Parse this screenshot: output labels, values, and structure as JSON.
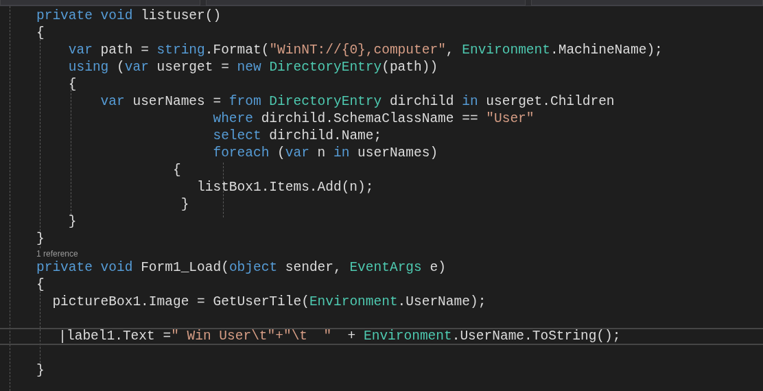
{
  "lines": [
    {
      "current": false,
      "tokens": [
        {
          "kind": "keyword",
          "text": "private"
        },
        {
          "kind": "keyword",
          "text": " void"
        },
        {
          "kind": "plain",
          "text": " listuser()"
        }
      ]
    },
    {
      "current": false,
      "tokens": [
        {
          "kind": "plain",
          "text": "{"
        }
      ]
    },
    {
      "current": false,
      "tokens": [
        {
          "kind": "keyword",
          "text": "    var"
        },
        {
          "kind": "plain",
          "text": " path = "
        },
        {
          "kind": "keyword",
          "text": "string"
        },
        {
          "kind": "plain",
          "text": ".Format("
        },
        {
          "kind": "string",
          "text": "\"WinNT://{0},computer\""
        },
        {
          "kind": "plain",
          "text": ", "
        },
        {
          "kind": "type",
          "text": "Environment"
        },
        {
          "kind": "plain",
          "text": ".MachineName);"
        }
      ]
    },
    {
      "current": false,
      "tokens": [
        {
          "kind": "keyword",
          "text": "    using"
        },
        {
          "kind": "plain",
          "text": " ("
        },
        {
          "kind": "keyword",
          "text": "var"
        },
        {
          "kind": "plain",
          "text": " userget = "
        },
        {
          "kind": "keyword",
          "text": "new"
        },
        {
          "kind": "type",
          "text": " DirectoryEntry"
        },
        {
          "kind": "plain",
          "text": "(path))"
        }
      ]
    },
    {
      "current": false,
      "tokens": [
        {
          "kind": "plain",
          "text": "    {"
        }
      ]
    },
    {
      "current": false,
      "tokens": [
        {
          "kind": "keyword",
          "text": "        var"
        },
        {
          "kind": "plain",
          "text": " userNames = "
        },
        {
          "kind": "keyword",
          "text": "from"
        },
        {
          "kind": "type",
          "text": " DirectoryEntry"
        },
        {
          "kind": "plain",
          "text": " dirchild "
        },
        {
          "kind": "keyword",
          "text": "in"
        },
        {
          "kind": "plain",
          "text": " userget.Children"
        }
      ]
    },
    {
      "current": false,
      "tokens": [
        {
          "kind": "keyword",
          "text": "                      where"
        },
        {
          "kind": "plain",
          "text": " dirchild.SchemaClassName == "
        },
        {
          "kind": "string",
          "text": "\"User\""
        }
      ]
    },
    {
      "current": false,
      "tokens": [
        {
          "kind": "keyword",
          "text": "                      select"
        },
        {
          "kind": "plain",
          "text": " dirchild.Name;"
        }
      ]
    },
    {
      "current": false,
      "tokens": [
        {
          "kind": "keyword",
          "text": "                      foreach"
        },
        {
          "kind": "plain",
          "text": " ("
        },
        {
          "kind": "keyword",
          "text": "var"
        },
        {
          "kind": "plain",
          "text": " n "
        },
        {
          "kind": "keyword",
          "text": "in"
        },
        {
          "kind": "plain",
          "text": " userNames)"
        }
      ]
    },
    {
      "current": false,
      "tokens": [
        {
          "kind": "plain",
          "text": "                 {"
        }
      ]
    },
    {
      "current": false,
      "tokens": [
        {
          "kind": "plain",
          "text": "                    listBox1.Items.Add(n);"
        }
      ]
    },
    {
      "current": false,
      "tokens": [
        {
          "kind": "plain",
          "text": "                  }"
        }
      ]
    },
    {
      "current": false,
      "tokens": [
        {
          "kind": "plain",
          "text": "    }"
        }
      ]
    },
    {
      "current": false,
      "tokens": [
        {
          "kind": "plain",
          "text": "}"
        }
      ]
    },
    {
      "current": false,
      "reference": "1 reference",
      "tokens": [
        {
          "kind": "keyword",
          "text": "private"
        },
        {
          "kind": "keyword",
          "text": " void"
        },
        {
          "kind": "plain",
          "text": " Form1_Load("
        },
        {
          "kind": "keyword",
          "text": "object"
        },
        {
          "kind": "plain",
          "text": " sender, "
        },
        {
          "kind": "type",
          "text": "EventArgs"
        },
        {
          "kind": "plain",
          "text": " e)"
        }
      ]
    },
    {
      "current": false,
      "tokens": [
        {
          "kind": "plain",
          "text": "{"
        }
      ]
    },
    {
      "current": false,
      "tokens": [
        {
          "kind": "plain",
          "text": "  pictureBox1.Image = GetUserTile("
        },
        {
          "kind": "type",
          "text": "Environment"
        },
        {
          "kind": "plain",
          "text": ".UserName);"
        }
      ]
    },
    {
      "current": false
    },
    {
      "current": true,
      "tokens": [
        {
          "kind": "plain",
          "text": "label1.Text ="
        },
        {
          "kind": "string",
          "text": "\" Win User\\t\"+\"\\t  \""
        },
        {
          "kind": "plain",
          "text": "  + "
        },
        {
          "kind": "type",
          "text": "Environment"
        },
        {
          "kind": "plain",
          "text": ".UserName.ToString();"
        }
      ]
    },
    {
      "current": false
    },
    {
      "current": false,
      "tokens": [
        {
          "kind": "plain",
          "text": "}"
        }
      ]
    }
  ]
}
